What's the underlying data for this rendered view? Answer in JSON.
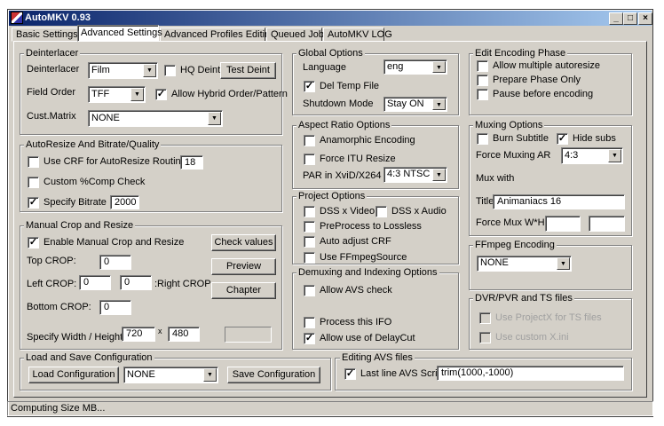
{
  "window": {
    "title": "AutoMKV 0.93",
    "minimize": "_",
    "maximize": "□",
    "close": "×"
  },
  "tabs": [
    {
      "label": "Basic Settings"
    },
    {
      "label": "Advanced Settings",
      "selected": true
    },
    {
      "label": "Advanced Profiles Editing"
    },
    {
      "label": "Queued Job"
    },
    {
      "label": "AutoMKV LOG"
    }
  ],
  "deinterlacer": {
    "title": "Deinterlacer",
    "deint_label": "Deinterlacer",
    "deint_value": "Film",
    "hq_label": "HQ Deint",
    "hq_checked": false,
    "test_button": "Test Deint",
    "field_order_label": "Field Order",
    "field_order_value": "TFF",
    "hybrid_label": "Allow Hybrid Order/Pattern",
    "hybrid_checked": true,
    "matrix_label": "Cust.Matrix",
    "matrix_value": "NONE"
  },
  "autoresize": {
    "title": "AutoResize And Bitrate/Quality",
    "crf_label": "Use CRF for AutoResize Routines",
    "crf_checked": false,
    "crf_value": "18",
    "comp_label": "Custom %Comp Check",
    "comp_checked": false,
    "bitrate_label": "Specify Bitrate",
    "bitrate_checked": true,
    "bitrate_value": "2000"
  },
  "crop": {
    "title": "Manual Crop and Resize",
    "enable_label": "Enable Manual Crop and Resize",
    "enable_checked": true,
    "check_button": "Check values",
    "preview_button": "Preview",
    "chapter_button": "Chapter",
    "top_label": "Top CROP:",
    "top_value": "0",
    "left_label": "Left CROP:",
    "left_value": "0",
    "right_value": "0",
    "right_label": ":Right CROP",
    "bottom_label": "Bottom CROP:",
    "bottom_value": "0",
    "wh_label": "Specify Width / Height",
    "width_value": "720",
    "x_sep": "x",
    "height_value": "480"
  },
  "config": {
    "title": "Load and Save Configuration",
    "load_button": "Load Configuration",
    "select_value": "NONE",
    "save_button": "Save Configuration"
  },
  "global": {
    "title": "Global Options",
    "language_label": "Language",
    "language_value": "eng",
    "deltemp_label": "Del Temp File",
    "deltemp_checked": true,
    "shutdown_label": "Shutdown Mode",
    "shutdown_value": "Stay ON"
  },
  "aspect": {
    "title": "Aspect Ratio Options",
    "anamorphic_label": "Anamorphic Encoding",
    "anamorphic_checked": false,
    "itu_label": "Force ITU Resize",
    "itu_checked": false,
    "par_label": "PAR in XviD/X264",
    "par_value": "4:3 NTSC"
  },
  "project": {
    "title": "Project Options",
    "dssv_label": "DSS x Video",
    "dssa_label": "DSS x Audio",
    "preprocess_label": "PreProcess to Lossless",
    "autocrf_label": "Auto adjust CRF",
    "ffms_label": "Use FFmpegSource"
  },
  "demux": {
    "title": "Demuxing and Indexing Options",
    "avscheck_label": "Allow AVS check",
    "ifo_label": "Process this IFO",
    "delaycut_label": "Allow use of DelayCut",
    "delaycut_checked": true
  },
  "avs": {
    "title": "Editing AVS files",
    "lastline_label": "Last line AVS Script",
    "lastline_checked": true,
    "script_value": "trim(1000,-1000)"
  },
  "encphase": {
    "title": "Edit Encoding Phase",
    "multi_label": "Allow multiple autoresize",
    "prepare_label": "Prepare Phase Only",
    "pause_label": "Pause before encoding"
  },
  "muxing": {
    "title": "Muxing Options",
    "burn_label": "Burn Subtitle",
    "burn_checked": false,
    "hide_label": "Hide subs",
    "hide_checked": true,
    "ar_label": "Force Muxing AR",
    "ar_value": "4:3",
    "muxwith_label": "Mux with",
    "title_label": "Title",
    "title_value": "Animaniacs 16",
    "wh_label": "Force Mux W*H",
    "w_value": "",
    "h_value": ""
  },
  "ffmpeg": {
    "title": "FFmpeg Encoding",
    "value": "NONE"
  },
  "dvr": {
    "title": "DVR/PVR and TS files",
    "projectx_label": "Use ProjectX for TS files",
    "customx_label": "Use custom X.ini"
  },
  "status": {
    "text": "Computing Size MB..."
  },
  "icons": {
    "check": "✓",
    "dropdown": "▼"
  }
}
